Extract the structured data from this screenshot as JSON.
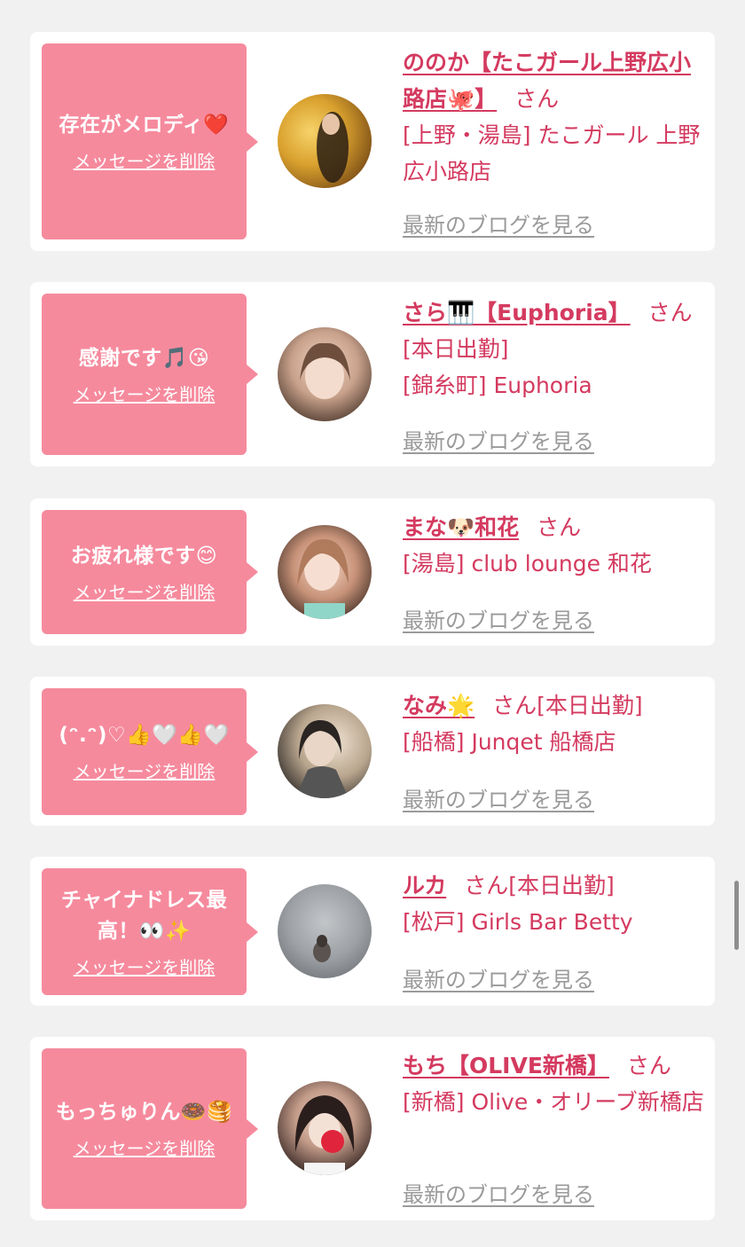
{
  "cards": [
    {
      "message": "存在がメロディ❤️",
      "delete_label": "メッセージを削除",
      "name": "ののか【たこガール上野広小路店🐙】",
      "san": "さん",
      "status": "",
      "shop": "[上野・湯島] たこガール 上野広小路店",
      "blog": "最新のブログを見る"
    },
    {
      "message": "感謝です🎵😘",
      "delete_label": "メッセージを削除",
      "name": "さら🎹【Euphoria】",
      "san": "さん",
      "status": "[本日出勤]",
      "shop": "[錦糸町] Euphoria",
      "blog": "最新のブログを見る"
    },
    {
      "message": "お疲れ様です😊",
      "delete_label": "メッセージを削除",
      "name": "まな🐶和花",
      "san": "さん",
      "status": "",
      "shop": "[湯島] club lounge 和花",
      "blog": "最新のブログを見る"
    },
    {
      "message": "(ᵔ.ᵔ)♡👍🤍👍🤍",
      "delete_label": "メッセージを削除",
      "name": "なみ🌟",
      "san": "さん",
      "status": "[本日出勤]",
      "shop": "[船橋] Junqet 船橋店",
      "blog": "最新のブログを見る"
    },
    {
      "message": "チャイナドレス最高！👀✨",
      "delete_label": "メッセージを削除",
      "name": "ルカ",
      "san": "さん",
      "status": "[本日出勤]",
      "shop": "[松戸] Girls Bar Betty",
      "blog": "最新のブログを見る"
    },
    {
      "message": "もっちゅりん🍩🥞",
      "delete_label": "メッセージを削除",
      "name": "もち【OLIVE新橋】",
      "san": "さん",
      "status": "",
      "shop": "[新橋] Olive・オリーブ新橋店",
      "blog": "最新のブログを見る"
    }
  ],
  "colors": {
    "bubble": "#f68a9d",
    "accent": "#d43a5f",
    "muted": "#9a9a9a",
    "background": "#f1f1f1"
  }
}
